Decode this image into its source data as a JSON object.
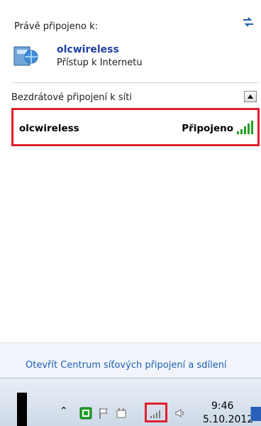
{
  "flyout": {
    "current_header": "Právě připojeno k:",
    "current_connection": {
      "name": "olcwireless",
      "status": "Přístup k Internetu"
    },
    "wireless_header": "Bezdrátové připojení k síti",
    "networks": [
      {
        "name": "olcwireless",
        "state": "Připojeno"
      }
    ],
    "footer_link": "Otevřít Centrum síťových připojení a sdílení"
  },
  "taskbar": {
    "time": "9:46",
    "date": "5.10.2012",
    "tray_icons": [
      "chevron-up-icon",
      "app-icon",
      "flag-icon",
      "power-icon",
      "network-signal-icon",
      "volume-icon"
    ]
  },
  "colors": {
    "accent_link": "#1f5fb0",
    "highlight": "#e0202f",
    "signal_green": "#21a121",
    "taskbar": "#cdd9e7"
  }
}
